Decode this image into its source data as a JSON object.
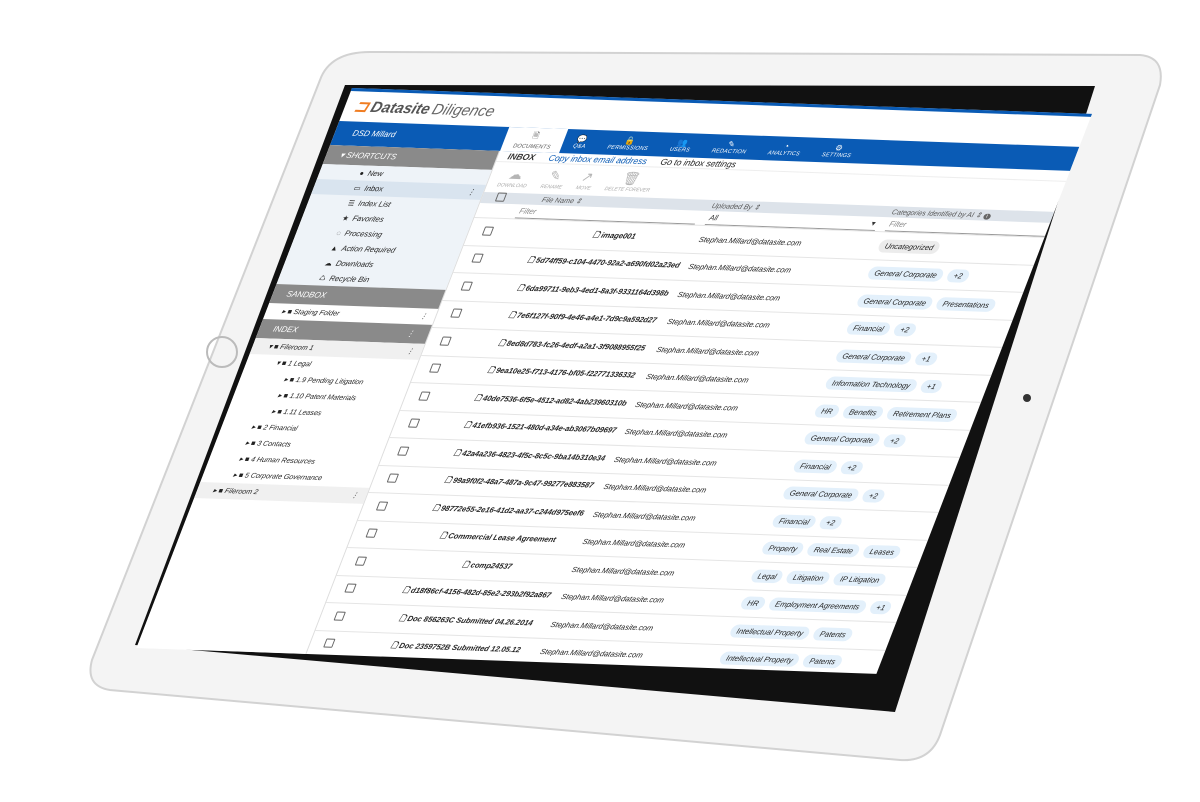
{
  "app": {
    "brand": "Datasite",
    "product": "Diligence",
    "user": "DSD Millard"
  },
  "nav": [
    {
      "label": "DOCUMENTS",
      "icon": "document-icon",
      "glyph": "🗎"
    },
    {
      "label": "Q&A",
      "icon": "chat-icon",
      "glyph": "💬"
    },
    {
      "label": "PERMISSIONS",
      "icon": "lock-icon",
      "glyph": "🔒"
    },
    {
      "label": "USERS",
      "icon": "users-icon",
      "glyph": "👥"
    },
    {
      "label": "REDACTION",
      "icon": "pen-icon",
      "glyph": "✎"
    },
    {
      "label": "ANALYTICS",
      "icon": "pie-chart-icon",
      "glyph": "◔"
    },
    {
      "label": "SETTINGS",
      "icon": "gear-icon",
      "glyph": "⚙"
    }
  ],
  "sidebar": {
    "shortcuts_label": "SHORTCUTS",
    "shortcuts": [
      {
        "label": "New",
        "glyph": "●"
      },
      {
        "label": "Inbox",
        "glyph": "▭"
      },
      {
        "label": "Index List",
        "glyph": "☰"
      },
      {
        "label": "Favorites",
        "glyph": "★"
      },
      {
        "label": "Processing",
        "glyph": "◌"
      },
      {
        "label": "Action Required",
        "glyph": "▲"
      },
      {
        "label": "Downloads",
        "glyph": "☁"
      },
      {
        "label": "Recycle Bin",
        "glyph": "♺"
      }
    ],
    "sandbox_label": "SANDBOX",
    "staging": "Staging Folder",
    "index_label": "INDEX",
    "tree": [
      {
        "label": "Fileroom 1",
        "level": 0,
        "open": true
      },
      {
        "label": "1 Legal",
        "level": 1,
        "open": true
      },
      {
        "label": "1.9 Pending Litigation",
        "level": 2
      },
      {
        "label": "1.10 Patent Materials",
        "level": 2
      },
      {
        "label": "1.11 Leases",
        "level": 2
      },
      {
        "label": "2 Financial",
        "level": 1
      },
      {
        "label": "3 Contacts",
        "level": 1
      },
      {
        "label": "4 Human Resources",
        "level": 1
      },
      {
        "label": "5 Corporate Governance",
        "level": 1
      },
      {
        "label": "Fileroom 2",
        "level": 0
      }
    ]
  },
  "inbox": {
    "title": "INBOX",
    "copy_link": "Copy inbox email address",
    "settings_link": "Go to inbox settings"
  },
  "toolbar": [
    {
      "label": "DOWNLOAD",
      "glyph": "☁"
    },
    {
      "label": "RENAME",
      "glyph": "✎"
    },
    {
      "label": "MOVE",
      "glyph": "↗"
    },
    {
      "label": "DELETE FOREVER",
      "glyph": "🗑"
    }
  ],
  "table": {
    "headers": {
      "name": "File Name ⇕",
      "uploaded": "Uploaded By ⇕",
      "categories": "Categories Identified by AI ⇕"
    },
    "filters": {
      "name_placeholder": "Filter",
      "uploaded_value": "All",
      "categories_placeholder": "Filter"
    },
    "rows": [
      {
        "name": "image001",
        "by": "Stephan.Millard@datasite.com",
        "tags": [
          "Uncategorized"
        ]
      },
      {
        "name": "5d74ff59-c104-4470-92a2-a690fd02a23ed",
        "by": "Stephan.Millard@datasite.com",
        "tags": [
          "General Corporate",
          "+2"
        ]
      },
      {
        "name": "6da99711-9eb3-4ed1-8a3f-9331164d398b",
        "by": "Stephan.Millard@datasite.com",
        "tags": [
          "General Corporate",
          "Presentations"
        ]
      },
      {
        "name": "7e6f127f-90f9-4e46-a4e1-7d9c9a592d27",
        "by": "Stephan.Millard@datasite.com",
        "tags": [
          "Financial",
          "+2"
        ]
      },
      {
        "name": "8ed8d783-fc26-4edf-a2a1-3f9088955f25",
        "by": "Stephan.Millard@datasite.com",
        "tags": [
          "General Corporate",
          "+1"
        ]
      },
      {
        "name": "9ea10e25-f713-4176-bf05-f22771336332",
        "by": "Stephan.Millard@datasite.com",
        "tags": [
          "Information Technology",
          "+1"
        ]
      },
      {
        "name": "40de7536-6f5e-4512-ad82-4ab23960310b",
        "by": "Stephan.Millard@datasite.com",
        "tags": [
          "HR",
          "Benefits",
          "Retirement Plans"
        ]
      },
      {
        "name": "41efb936-1521-480d-a34e-ab3067b09697",
        "by": "Stephan.Millard@datasite.com",
        "tags": [
          "General Corporate",
          "+2"
        ]
      },
      {
        "name": "42a4a236-4823-4f5c-8c5c-9ba14b310e34",
        "by": "Stephan.Millard@datasite.com",
        "tags": [
          "Financial",
          "+2"
        ]
      },
      {
        "name": "99a9f0f2-48a7-487a-9c47-99277e883587",
        "by": "Stephan.Millard@datasite.com",
        "tags": [
          "General Corporate",
          "+2"
        ]
      },
      {
        "name": "98772e55-2e16-41d2-aa37-c244d975eef6",
        "by": "Stephan.Millard@datasite.com",
        "tags": [
          "Financial",
          "+2"
        ]
      },
      {
        "name": "Commercial Lease Agreement",
        "by": "Stephan.Millard@datasite.com",
        "tags": [
          "Property",
          "Real Estate",
          "Leases"
        ]
      },
      {
        "name": "comp24537",
        "by": "Stephan.Millard@datasite.com",
        "tags": [
          "Legal",
          "Litigation",
          "IP Litigation"
        ]
      },
      {
        "name": "d18f86cf-4156-482d-85e2-293b2f92a867",
        "by": "Stephan.Millard@datasite.com",
        "tags": [
          "HR",
          "Employment Agreements",
          "+1"
        ]
      },
      {
        "name": "Doc 856263C Submitted 04.26.2014",
        "by": "Stephan.Millard@datasite.com",
        "tags": [
          "Intellectual Property",
          "Patents"
        ]
      },
      {
        "name": "Doc 2359752B Submitted 12.05.12",
        "by": "Stephan.Millard@datasite.com",
        "tags": [
          "Intellectual Property",
          "Patents"
        ]
      }
    ]
  },
  "colors": {
    "brand_blue": "#0a5bb5",
    "logo_orange": "#f07d22",
    "section_gray": "#8a8a8a",
    "tag_blue": "#e3f0fb"
  }
}
